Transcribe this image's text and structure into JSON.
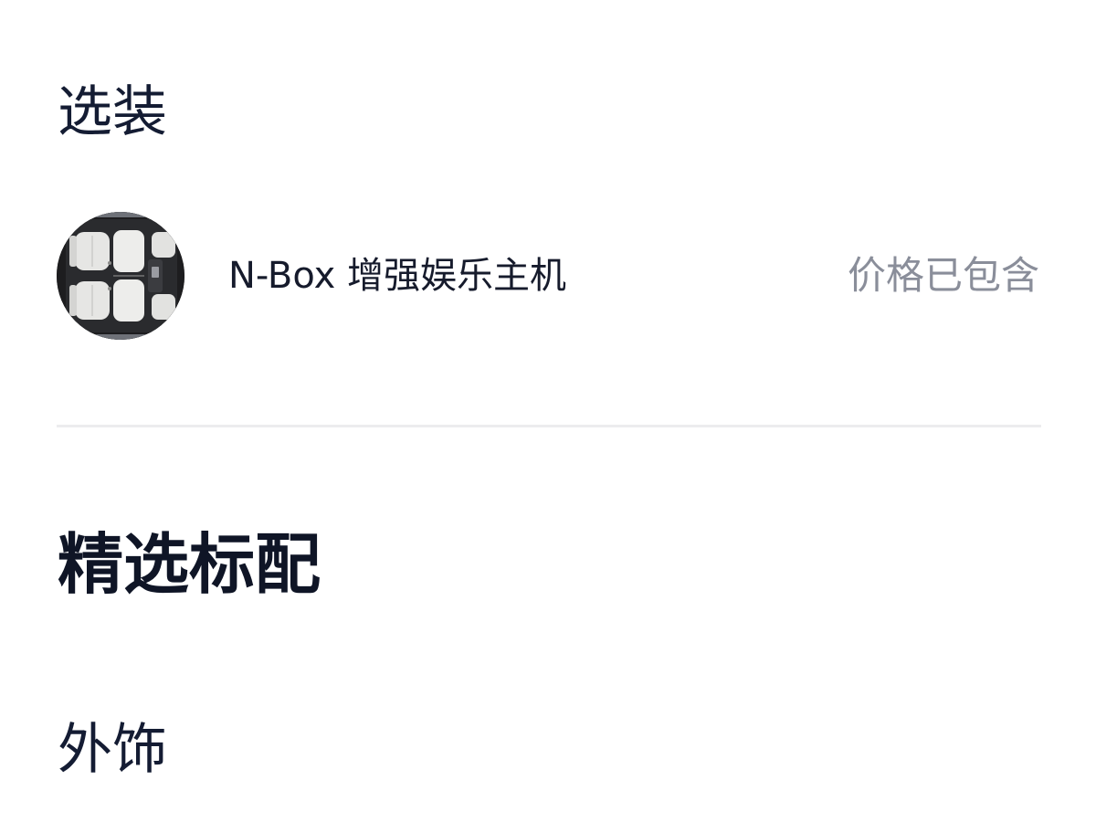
{
  "sections": {
    "options_title": "选装",
    "featured_title": "精选标配",
    "exterior_title": "外饰"
  },
  "option": {
    "name": "N-Box 增强娱乐主机",
    "price_status": "价格已包含",
    "image_icon": "car-interior-top-view"
  },
  "colors": {
    "title": "#141c33",
    "muted": "#8a8e9a",
    "divider": "#ececee"
  }
}
